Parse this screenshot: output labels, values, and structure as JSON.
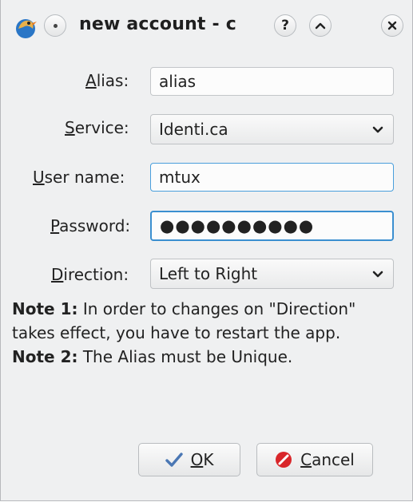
{
  "window": {
    "title": "new account - c",
    "help_glyph": "?",
    "shade_glyph": "^",
    "close_glyph": "×"
  },
  "form": {
    "alias": {
      "label_first": "A",
      "label_rest": "lias:",
      "value": "alias"
    },
    "service": {
      "label_first": "S",
      "label_rest": "ervice:",
      "value": "Identi.ca"
    },
    "username": {
      "label_first": "U",
      "label_rest": "ser name:",
      "value": "mtux"
    },
    "password": {
      "label_first": "P",
      "label_rest": "assword:",
      "value": "●●●●●●●●●●"
    },
    "direction": {
      "label_first": "D",
      "label_rest": "irection:",
      "value": "Left to Right"
    }
  },
  "notes": {
    "note1_label": "Note 1:",
    "note1_text": " In order to changes on \"Direction\" takes effect, you have to restart the app.",
    "note2_label": "Note 2:",
    "note2_text": " The Alias must be Unique."
  },
  "buttons": {
    "ok_first": "O",
    "ok_rest": "K",
    "cancel_first": "C",
    "cancel_rest": "ancel"
  },
  "icons": {
    "app": "twitter-bird-icon",
    "menu": "window-menu-icon",
    "help": "help-icon",
    "shade": "shade-icon",
    "close": "close-icon",
    "ok": "checkmark-icon",
    "cancel": "cancel-icon",
    "dropdown": "chevron-down-icon"
  },
  "colors": {
    "focus_border": "#4a9fdc",
    "cancel_red": "#d9262a",
    "ok_blue": "#4a77b4"
  }
}
